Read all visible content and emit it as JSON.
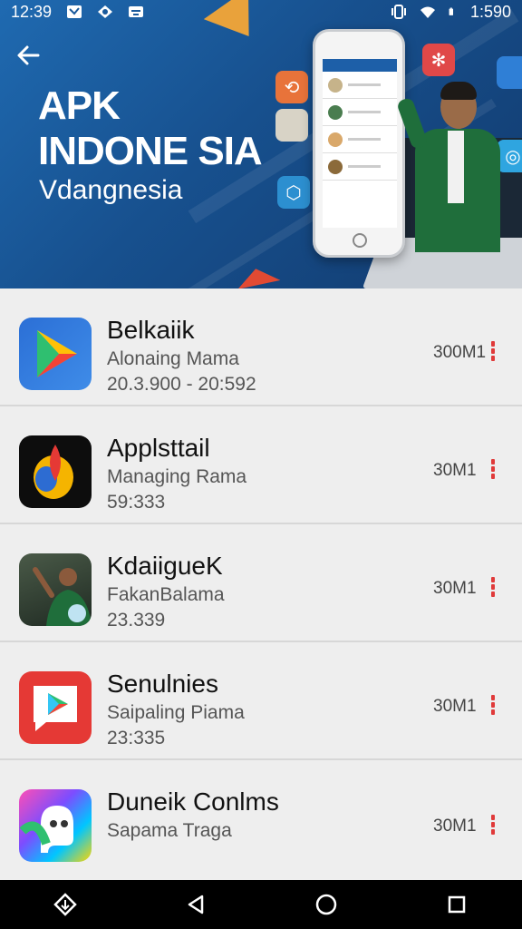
{
  "status_bar": {
    "time_left": "12:39",
    "time_right": "1:590",
    "icons": [
      "message-icon",
      "location-icon",
      "cast-icon",
      "vibrate-icon",
      "wifi-icon",
      "battery-icon"
    ]
  },
  "banner": {
    "title_line1": "APK",
    "title_line2": "INDONE SIA",
    "subtitle": "Vdangnesia",
    "back_icon": "arrow-left-icon",
    "colors": {
      "background": "#1a5a9c",
      "accent": "#e9a23b"
    }
  },
  "apps": [
    {
      "name": "Belkaiik",
      "developer": "Alonaing Mama",
      "meta": "20.3.900 - 20:592",
      "size": "300M1",
      "icon": "play-store-icon"
    },
    {
      "name": "Applsttail",
      "developer": "Managing Rama",
      "meta": "59:333",
      "size": "30M1",
      "icon": "flame-icon"
    },
    {
      "name": "KdaiigueK",
      "developer": "FakanBalama",
      "meta": "23.339",
      "size": "30M1",
      "icon": "person-photo-icon"
    },
    {
      "name": "Senulnies",
      "developer": "Saipaling Piama",
      "meta": "23:335",
      "size": "30M1",
      "icon": "play-message-icon"
    },
    {
      "name": "Duneik Conlms",
      "developer": "Sapama Traga",
      "meta": "",
      "size": "30M1",
      "icon": "colorful-ghost-icon"
    }
  ],
  "nav": {
    "buttons": [
      "diamond-down-icon",
      "back-triangle-icon",
      "home-circle-icon",
      "recents-square-icon"
    ]
  }
}
